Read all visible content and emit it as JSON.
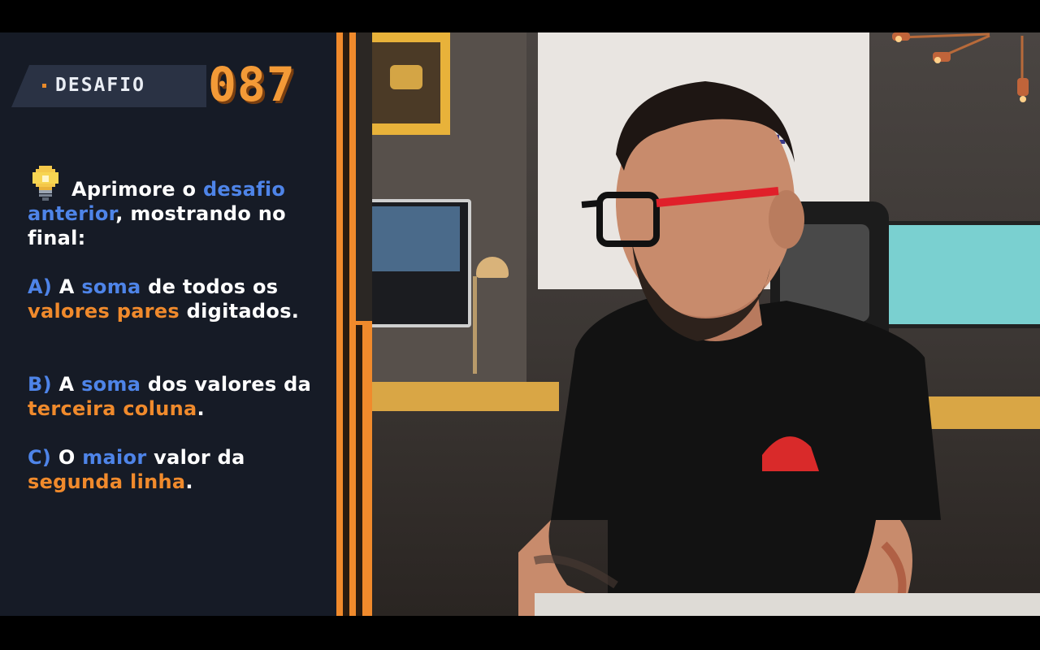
{
  "challenge": {
    "label": "DESAFIO",
    "number": "087",
    "intro": {
      "p1": "Aprimore o ",
      "h1": "desafio anterior",
      "p2": ", mostrando no final:"
    },
    "items": [
      {
        "letter": "A)",
        "p1": " A ",
        "h1": "soma",
        "p2": " de todos os ",
        "h2": "valores pares",
        "p3": " digitados."
      },
      {
        "letter": "B)",
        "p1": " A ",
        "h1": "soma",
        "p2": " dos valores da ",
        "h2": "terceira coluna",
        "p3": "."
      },
      {
        "letter": "C)",
        "p1": " O ",
        "h1": "maior",
        "p2": " valor da ",
        "h2": "segunda linha",
        "p3": "."
      }
    ]
  },
  "colors": {
    "accent_orange": "#f08a2c",
    "accent_blue": "#4e84e8",
    "panel_bg": "#161b26",
    "shirt": "#111111",
    "glasses_red": "#e0202a"
  },
  "icons": {
    "bulb": "lightbulb-icon"
  }
}
